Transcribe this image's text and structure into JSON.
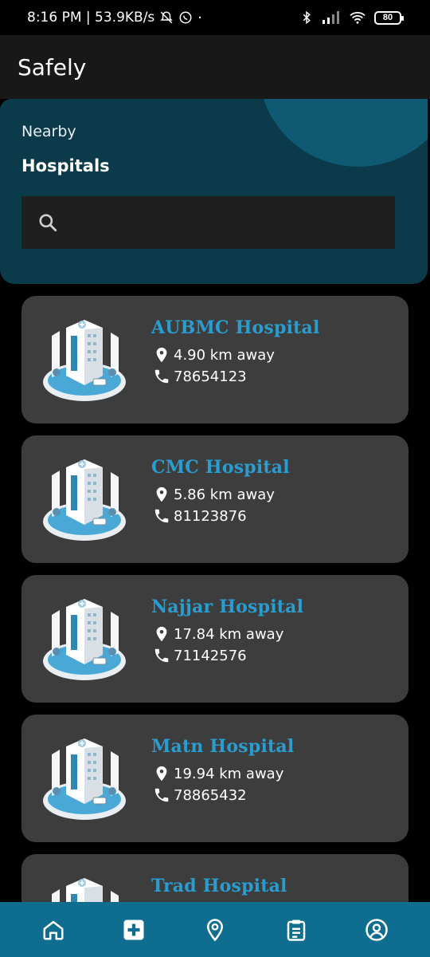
{
  "status": {
    "time_speed": "8:16 PM | 53.9KB/s",
    "battery": "80"
  },
  "app": {
    "title": "Safely"
  },
  "header": {
    "line1": "Nearby",
    "line2": "Hospitals"
  },
  "search": {
    "value": "",
    "placeholder": ""
  },
  "hospitals": [
    {
      "name": "AUBMC Hospital",
      "distance": "4.90 km away",
      "phone": "78654123"
    },
    {
      "name": "CMC Hospital",
      "distance": "5.86 km away",
      "phone": "81123876"
    },
    {
      "name": "Najjar Hospital",
      "distance": "17.84 km away",
      "phone": "71142576"
    },
    {
      "name": "Matn Hospital",
      "distance": "19.94 km away",
      "phone": "78865432"
    },
    {
      "name": "Trad Hospital",
      "distance": "",
      "phone": ""
    }
  ],
  "nav": {
    "items": [
      "home-icon",
      "hospital-cross-icon",
      "location-pin-icon",
      "clipboard-icon",
      "profile-icon"
    ]
  },
  "colors": {
    "header_bg": "#0b3a4b",
    "accent": "#2a9dd0",
    "card_bg": "#3d3d3d",
    "nav_bg": "#0f6d90"
  }
}
